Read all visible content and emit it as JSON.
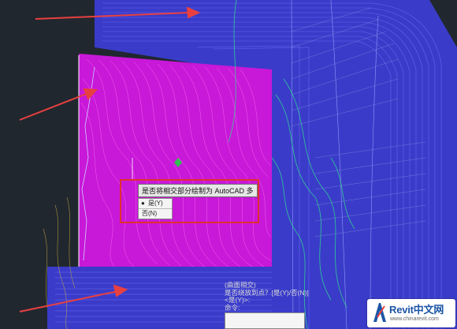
{
  "dialog": {
    "prompt": "是否将相交部分绘制为 AutoCAD 多段线？",
    "options": [
      {
        "label": "是(Y)",
        "selected": true
      },
      {
        "label": "否(N)",
        "selected": false
      }
    ]
  },
  "command_line": {
    "lines": [
      "(曲面相交)",
      "是否绕放到点？[是(Y)/否(N)]",
      "<是(Y)>:",
      "命令:"
    ]
  },
  "watermark": {
    "brand": "Revit中文网",
    "url": "www.chinarevit.com"
  },
  "colors": {
    "background": "#21272f",
    "surface": "#c818d8",
    "contour_blue": "#5a5af0",
    "contour_green": "#30e090",
    "arrow": "#e84040",
    "highlight_box": "#e03030",
    "brand": "#1c55a5"
  }
}
